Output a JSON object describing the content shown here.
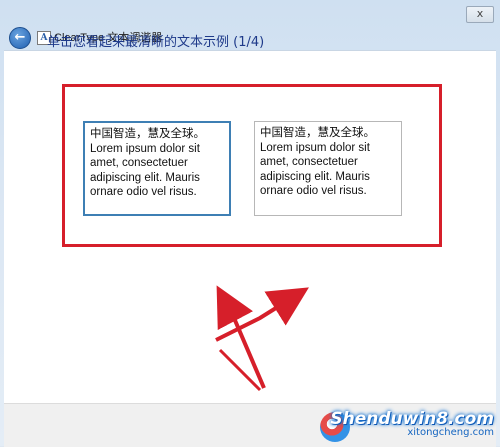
{
  "window": {
    "title": "ClearType 文本调谐器",
    "close_label": "x",
    "back_icon": "back-arrow-icon",
    "app_icon_letter": "A"
  },
  "page": {
    "instruction": "单击您看起来最清晰的文本示例 (1/4)"
  },
  "samples": [
    {
      "line1": "中国智造，慧及全球。",
      "line2": "Lorem ipsum dolor sit amet, consectetuer adipiscing elit. Mauris ornare odio vel risus.",
      "selected": true
    },
    {
      "line1": "中国智造，慧及全球。",
      "line2": "Lorem ipsum dolor sit amet, consectetuer adipiscing elit. Mauris ornare odio vel risus.",
      "selected": false
    }
  ],
  "annotation": {
    "highlight_color": "#d61f2a"
  },
  "watermark": {
    "main": "Shenduwin8.com",
    "sub": "xitongcheng.com"
  }
}
